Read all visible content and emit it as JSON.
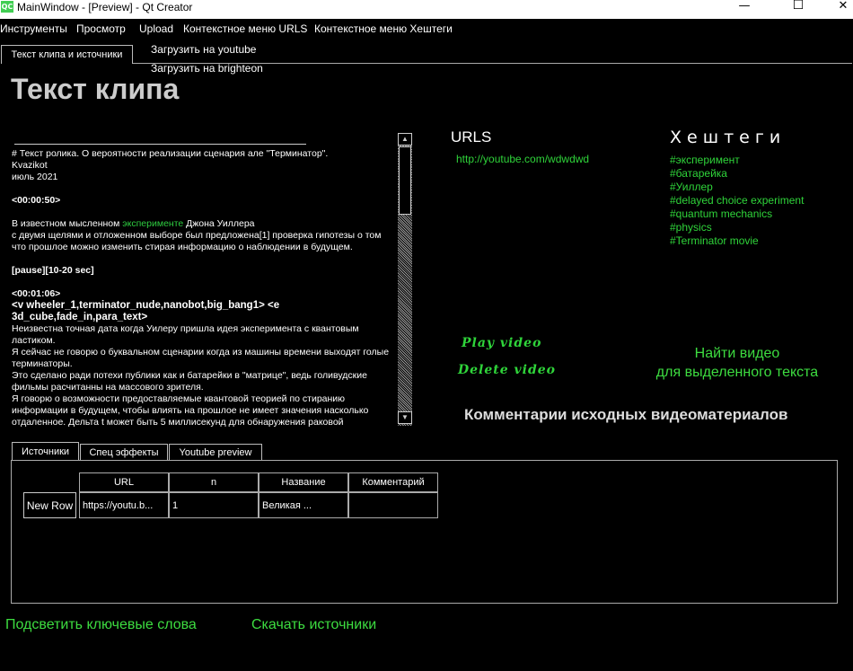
{
  "window": {
    "title": "MainWindow - [Preview] - Qt Creator",
    "logo_text": "QC",
    "minimize": "—",
    "maximize": "☐",
    "close": "✕"
  },
  "menu": [
    {
      "label": "Инструменты"
    },
    {
      "label": "Просмотр"
    },
    {
      "label": "Upload"
    },
    {
      "label": "Контекстное меню URLS"
    },
    {
      "label": "Контекстное меню Хештеги"
    }
  ],
  "upload_menu": [
    "Загрузить на youtube",
    "Загрузить на brighteon"
  ],
  "main_tabs": [
    "Текст клипа и источники"
  ],
  "page_title": "Текст клипа",
  "clip_text": {
    "line1": "# Текст ролика. О вероятности реализации сценария але \"Терминатор\".",
    "author": "Kvazikot",
    "date": "июль 2021",
    "ts1": "<00:00:50>",
    "p1_before": "В известном мысленном ",
    "p1_link": "эксперименте",
    "p1_after": " Джона Уиллера",
    "p1_rest": "с двумя щелями и отложенном выборе был предложена[1] проверка гипотезы о том что прошлое можно изменить стирая информацию о наблюдении в будущем.",
    "pause": "[pause][10-20 sec]",
    "ts2": "<00:01:06>",
    "tags": "<v wheeler_1,terminator_nude,nanobot,big_bang1> <e 3d_cube,fade_in,para_text>",
    "p2": "Неизвестна точная дата когда Уилеру пришла идея эксперимента с квантовым ластиком.",
    "p3": "Я сейчас не говорю о буквальном сценарии когда из машины времени выходят голые терминаторы.",
    "p4": "Это сделано ради потехи публики как и батарейки в \"матрице\", ведь голивудские фильмы расчитанны на массового зрителя.",
    "p5": "Я говорю о возможности предоставляемые квантовой теорией по стиранию информации в будущем, чтобы влиять на прошлое не имеет значения насколько отдаленное. Дельта t может быть 5 миллисекунд для обнаружения раковой"
  },
  "scroll": {
    "up": "▲",
    "down": "▼"
  },
  "urls": {
    "heading": "URLS",
    "items": [
      "http://youtube.com/wdwdwd"
    ]
  },
  "hashtags": {
    "heading": "Хештеги",
    "items": [
      "#эксперимент",
      "#батарейка",
      "#Уиллер",
      "#delayed choice experiment",
      "#quantum mechanics",
      "#physics",
      "#Terminator movie"
    ]
  },
  "buttons": {
    "play_video": "Play video",
    "delete_video": "Delete video",
    "find_video_1": "Найти видео",
    "find_video_2": "для выделенного текста",
    "comments_heading": "Комментарии исходных видеоматериалов",
    "highlight_keywords": "Подсветить ключевые слова",
    "download_sources": "Скачать источники"
  },
  "bottom_tabs": [
    "Источники",
    "Спец эффекты",
    "Youtube preview"
  ],
  "sources_table": {
    "columns": [
      "URL",
      "n",
      "Название",
      "Комментарий"
    ],
    "rows": [
      {
        "row_header": "New Row",
        "cells": [
          "https://youtu.b...",
          "1",
          "Великая ...",
          ""
        ]
      }
    ]
  },
  "colors": {
    "accent_green": "#3ddc40",
    "background": "#000000"
  }
}
